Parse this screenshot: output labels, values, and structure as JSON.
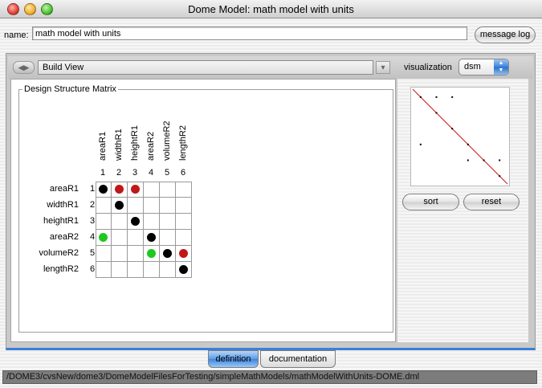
{
  "window": {
    "title": "Dome Model: math model with units"
  },
  "name_row": {
    "label": "name:",
    "value": "math model with units",
    "message_log_label": "message log"
  },
  "toolbar": {
    "view_value": "Build View",
    "visualization_label": "visualization",
    "visualization_value": "dsm"
  },
  "dsm": {
    "title": "Design Structure Matrix",
    "columns": [
      "areaR1",
      "widthR1",
      "heightR1",
      "areaR2",
      "volumeR2",
      "lengthR2"
    ],
    "column_indices": [
      "1",
      "2",
      "3",
      "4",
      "5",
      "6"
    ],
    "rows": [
      "areaR1",
      "widthR1",
      "heightR1",
      "areaR2",
      "volumeR2",
      "lengthR2"
    ],
    "row_indices": [
      "1",
      "2",
      "3",
      "4",
      "5",
      "6"
    ],
    "marks": [
      {
        "row": 1,
        "col": 1,
        "color": "black"
      },
      {
        "row": 1,
        "col": 2,
        "color": "red"
      },
      {
        "row": 1,
        "col": 3,
        "color": "red"
      },
      {
        "row": 2,
        "col": 2,
        "color": "black"
      },
      {
        "row": 3,
        "col": 3,
        "color": "black"
      },
      {
        "row": 4,
        "col": 1,
        "color": "green"
      },
      {
        "row": 4,
        "col": 4,
        "color": "black"
      },
      {
        "row": 5,
        "col": 4,
        "color": "green"
      },
      {
        "row": 5,
        "col": 5,
        "color": "black"
      },
      {
        "row": 5,
        "col": 6,
        "color": "red"
      },
      {
        "row": 6,
        "col": 6,
        "color": "black"
      }
    ],
    "colors": {
      "black": "#000000",
      "red": "#c01818",
      "green": "#1ec81e"
    }
  },
  "side": {
    "sort_label": "sort",
    "reset_label": "reset",
    "diagonal_color": "#d01010"
  },
  "tabs": {
    "definition_label": "definition",
    "documentation_label": "documentation"
  },
  "status": {
    "path": "/DOME3/cvsNew/dome3/DomeModelFilesForTesting/simpleMathModels/mathModelWithUnits-DOME.dml"
  }
}
